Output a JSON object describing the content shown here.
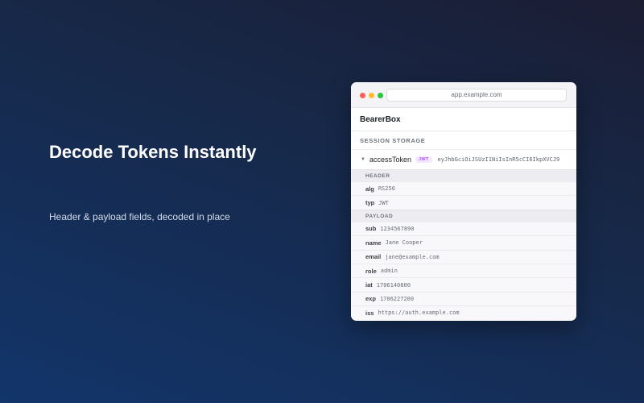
{
  "hero": {
    "headline": "Decode Tokens Instantly",
    "subline": "Header & payload fields, decoded in place"
  },
  "window": {
    "url": "app.example.com",
    "app_title": "BearerBox",
    "section": "SESSION STORAGE",
    "token": {
      "key": "accessToken",
      "badge": "JWT",
      "value": "eyJhbGciOiJSUzI1NiIsInR5cCI6IkpXVCJ9"
    },
    "header_label": "HEADER",
    "header_fields": [
      {
        "key": "alg",
        "value": "RS256"
      },
      {
        "key": "typ",
        "value": "JWT"
      }
    ],
    "payload_label": "PAYLOAD",
    "payload_fields": [
      {
        "key": "sub",
        "value": "1234567890"
      },
      {
        "key": "name",
        "value": "Jane Cooper"
      },
      {
        "key": "email",
        "value": "jane@example.com"
      },
      {
        "key": "role",
        "value": "admin"
      },
      {
        "key": "iat",
        "value": "1706140800"
      },
      {
        "key": "exp",
        "value": "1706227200"
      },
      {
        "key": "iss",
        "value": "https://auth.example.com"
      }
    ]
  },
  "colors": {
    "badge_text": "#a855f7",
    "badge_bg": "#f3e8ff",
    "window_close": "#ff5f57",
    "window_minimize": "#febc2e",
    "window_zoom": "#28c840"
  },
  "icons": {
    "caret": "caret-down-icon"
  }
}
